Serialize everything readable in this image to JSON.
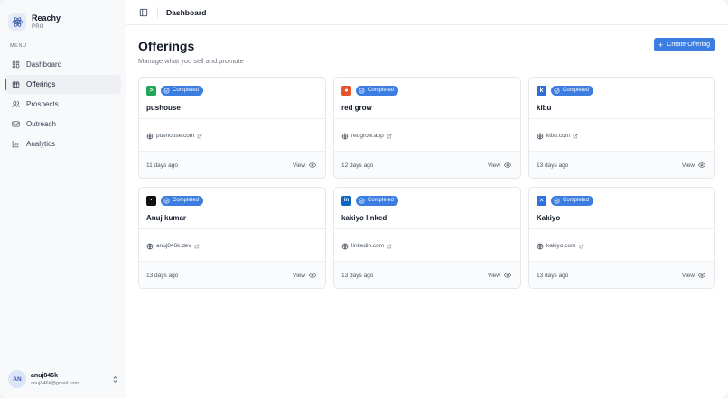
{
  "brand": {
    "name": "Reachy",
    "plan": "PRO",
    "logo_icon": "react-atom-icon"
  },
  "sidebar": {
    "menu_label": "MENU",
    "items": [
      {
        "label": "Dashboard",
        "icon": "dashboard-grid-icon",
        "active": false
      },
      {
        "label": "Offerings",
        "icon": "package-icon",
        "active": true
      },
      {
        "label": "Prospects",
        "icon": "users-icon",
        "active": false
      },
      {
        "label": "Outreach",
        "icon": "mail-icon",
        "active": false
      },
      {
        "label": "Analytics",
        "icon": "bar-chart-icon",
        "active": false
      }
    ]
  },
  "user": {
    "initials": "AN",
    "name": "anuj846k",
    "email": "anuj846k@gmail.com"
  },
  "topbar": {
    "title": "Dashboard"
  },
  "page": {
    "title": "Offerings",
    "subtitle": "Manage what you sell and promote",
    "create_label": "Create Offering"
  },
  "colors": {
    "accent": "#3b7de0",
    "active_indicator": "#2563eb"
  },
  "offerings": [
    {
      "name": "pushouse",
      "status": "Completed",
      "domain": "pushouse.com",
      "age": "11 days ago",
      "view_label": "View",
      "logo": {
        "color": "#22a55a",
        "glyph": ">"
      }
    },
    {
      "name": "red grow",
      "status": "Completed",
      "domain": "redgrow.app",
      "age": "12 days ago",
      "view_label": "View",
      "logo": {
        "color": "#e8542c",
        "glyph": "●"
      }
    },
    {
      "name": "kibu",
      "status": "Completed",
      "domain": "kibu.com",
      "age": "13 days ago",
      "view_label": "View",
      "logo": {
        "color": "#2d6fd6",
        "glyph": "k"
      }
    },
    {
      "name": "Anuj kumar",
      "status": "Completed",
      "domain": "anuj846k.dev",
      "age": "13 days ago",
      "view_label": "View",
      "logo": {
        "color": "#111111",
        "glyph": "·"
      }
    },
    {
      "name": "kakiyo linked",
      "status": "Completed",
      "domain": "linkedin.com",
      "age": "13 days ago",
      "view_label": "View",
      "logo": {
        "color": "#0a66c2",
        "glyph": "in"
      }
    },
    {
      "name": "Kakiyo",
      "status": "Completed",
      "domain": "kakiyo.com",
      "age": "13 days ago",
      "view_label": "View",
      "logo": {
        "color": "#2f6fe0",
        "glyph": "✕"
      }
    }
  ]
}
